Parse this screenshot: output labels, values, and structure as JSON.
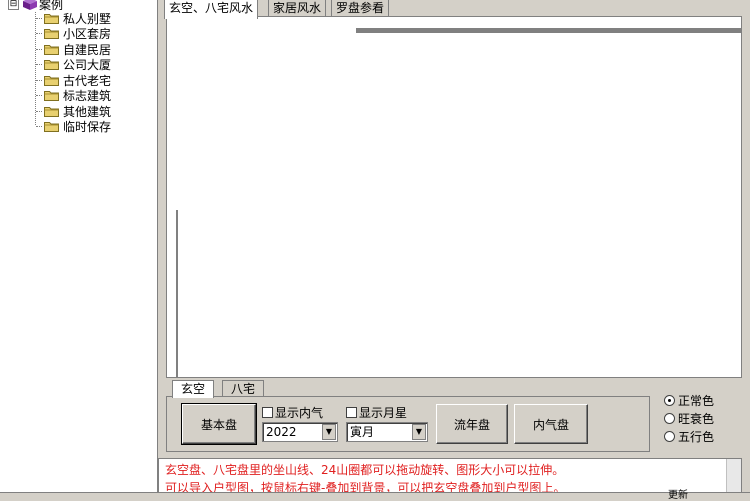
{
  "tree": {
    "root_label": "案例",
    "expand_glyph": "⊟",
    "items": [
      "私人别墅",
      "小区套房",
      "自建民居",
      "公司大厦",
      "古代老宅",
      "标志建筑",
      "其他建筑",
      "临时保存"
    ]
  },
  "tabs": [
    "玄空、八宅风水",
    "家居风水",
    "罗盘参看"
  ],
  "subtabs": [
    "玄空",
    "八宅"
  ],
  "controls": {
    "basic_chart_label": "基本盘",
    "show_inner_qi_label": "显示内气",
    "show_month_star_label": "显示月星",
    "year_value": "2022",
    "month_value": "寅月",
    "annual_chart_label": "流年盘",
    "inner_qi_chart_label": "内气盘",
    "dropdown_glyph": "▼"
  },
  "color_options": [
    {
      "label": "正常色",
      "selected": true
    },
    {
      "label": "旺衰色",
      "selected": false
    },
    {
      "label": "五行色",
      "selected": false
    }
  ],
  "info_lines": [
    "玄空盘、八宅盘里的坐山线、24山圈都可以拖动旋转、图形大小可以拉伸。",
    "可以导入户型图，按鼠标右键-叠加到背景，可以把玄空盘叠加到户型图上。"
  ],
  "status_text": "更新",
  "colors": {
    "info_text": "#e02020",
    "window_bg": "#d4d0c8"
  }
}
